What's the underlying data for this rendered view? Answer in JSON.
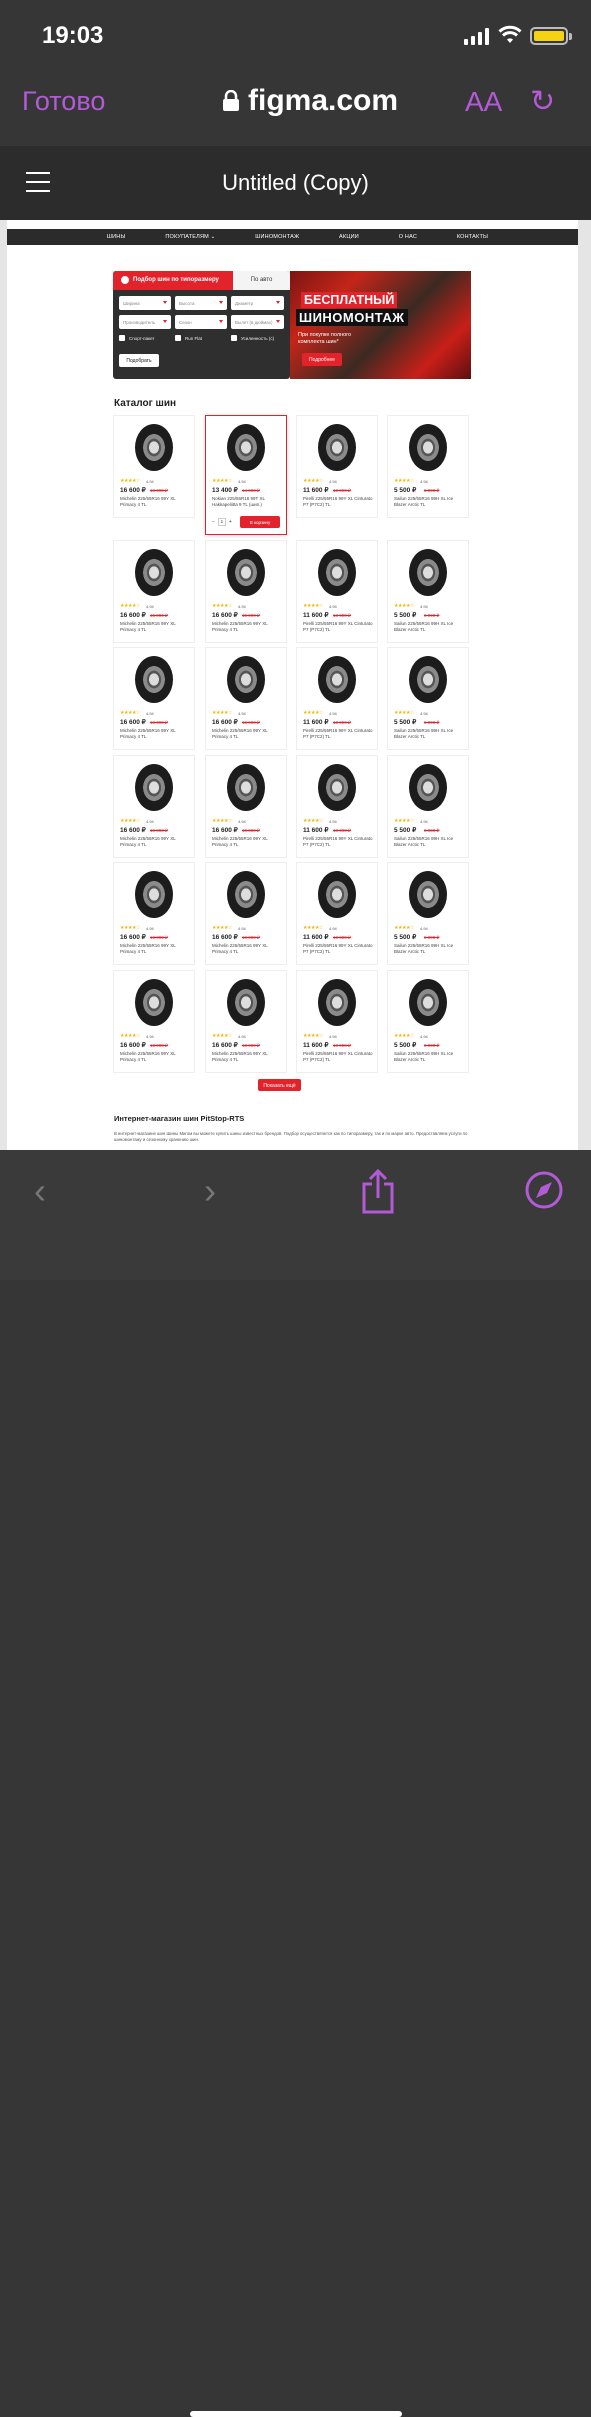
{
  "status": {
    "time": "19:03"
  },
  "browser": {
    "done": "Готово",
    "domain": "figma.com",
    "text_size": "AA"
  },
  "figma": {
    "title": "Untitled (Copy)"
  },
  "site": {
    "nav": [
      "ШИНЫ",
      "ПОКУПАТЕЛЯМ ⌄",
      "ШИНОМОНТАЖ",
      "АКЦИИ",
      "О НАС",
      "КОНТАКТЫ"
    ],
    "filter": {
      "tab_active": "Подбор шин по типоразмеру",
      "tab_other": "По авто",
      "selects": [
        "Ширина",
        "Высота",
        "Диаметр",
        "Производитель",
        "Сезон",
        "Вылет (в дюймах)"
      ],
      "checks": [
        "Спорт-пакет",
        "Run Flat",
        "Усиленность (с)"
      ],
      "button": "Подобрать"
    },
    "banner": {
      "line1": "БЕСПЛАТНЫЙ",
      "line2": "ШИНОМОНТАЖ",
      "text": "При покупке полного комплекта шин*",
      "button": "Подробнее"
    },
    "catalog_title": "Каталог шин",
    "products": [
      {
        "name": "Michelin 225/55R16 99Y XL Primacy 4 TL",
        "price": "16 600 ₽",
        "old": "18 990 ₽",
        "rating": "4.94"
      },
      {
        "name": "Nokian 225/55R16 99T XL Hakkapeliitta 9 TL (шип.)",
        "price": "13 400 ₽",
        "old": "14 990 ₽",
        "rating": "4.94"
      },
      {
        "name": "Pirelli 225/55R16 99Y XL Cinturato P7 (P7C2) TL",
        "price": "11 600 ₽",
        "old": "13 990 ₽",
        "rating": "4.94"
      },
      {
        "name": "Sailun 225/55R16 99H XL Ice Blazer Arctic TL",
        "price": "5 500 ₽",
        "old": "6 990 ₽",
        "rating": "4.94"
      }
    ],
    "cart": {
      "qty": "1",
      "minus": "−",
      "plus": "+",
      "button": "В корзину"
    },
    "show_more": "Показать ещё",
    "shop_title": "Интернет-магазин шин PitStop-RTS",
    "shop_text": "В интернет-магазине шин Шины Мигом вы можете купить шины известных брендов. Подбор осуществляется как по типоразмеру, так и по марке авто. Предоставляем услуги по шиномонтажу и сезонному хранению шин."
  }
}
